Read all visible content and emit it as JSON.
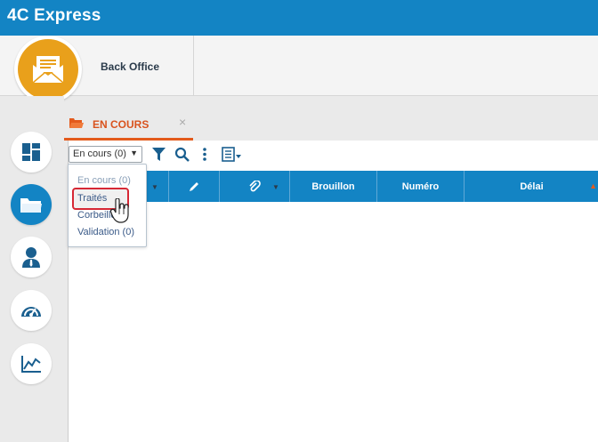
{
  "app": {
    "title": "4C Express"
  },
  "header": {
    "label": "Back Office",
    "logo_icon": "envelope-icon"
  },
  "sidebar": {
    "items": [
      {
        "name": "dashboard",
        "icon": "dashboard-icon",
        "active": false
      },
      {
        "name": "folder",
        "icon": "folder-icon",
        "active": true
      },
      {
        "name": "user",
        "icon": "user-icon",
        "active": false
      },
      {
        "name": "gauge",
        "icon": "gauge-icon",
        "active": false
      },
      {
        "name": "chart",
        "icon": "line-chart-icon",
        "active": false
      }
    ]
  },
  "tab": {
    "label": "EN COURS",
    "close": "×"
  },
  "toolbar": {
    "filter_value": "En cours (0)",
    "filter_arrow": "▼"
  },
  "grid": {
    "columns": [
      "Brouillon",
      "Numéro",
      "Délai"
    ]
  },
  "dropdown": {
    "options": [
      "En cours (0)",
      "Traités",
      "Corbeille",
      "Validation (0)"
    ]
  },
  "colors": {
    "primary": "#1384c4",
    "accent": "#e35a1c",
    "logo": "#e9a01b",
    "highlight": "#d62835"
  }
}
